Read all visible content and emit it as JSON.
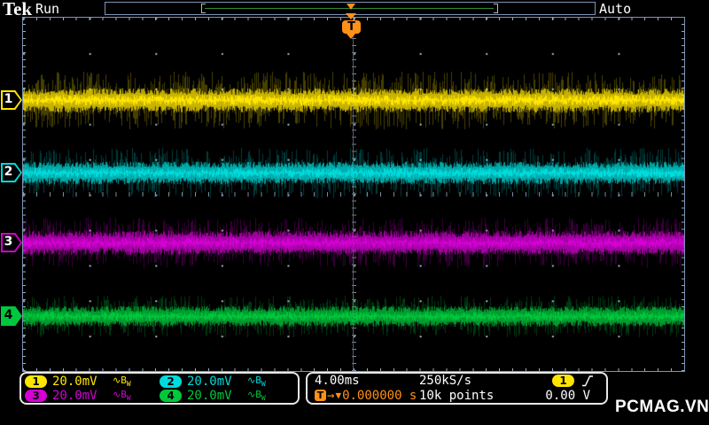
{
  "header": {
    "logo": "Tek",
    "acq_state": "Run",
    "trigger_mode": "Auto"
  },
  "channels": [
    {
      "label": "1",
      "scale": "20.0mV",
      "color": "#ffe600",
      "marker_filled": false,
      "trace": {
        "center": 94,
        "core": 14,
        "spike": 26
      }
    },
    {
      "label": "2",
      "scale": "20.0mV",
      "color": "#00dbdb",
      "marker_filled": false,
      "trace": {
        "center": 176,
        "core": 13,
        "spike": 22
      }
    },
    {
      "label": "3",
      "scale": "20.0mV",
      "color": "#d400d4",
      "marker_filled": false,
      "trace": {
        "center": 255,
        "core": 14,
        "spike": 22
      }
    },
    {
      "label": "4",
      "scale": "20.0mV",
      "color": "#00c83c",
      "marker_filled": true,
      "trace": {
        "center": 338,
        "core": 12,
        "spike": 18
      }
    }
  ],
  "icons": {
    "coupling_glyph": "∿",
    "bw_main": "B",
    "bw_sub": "W",
    "delay_t": "T",
    "delay_arrow": "→",
    "delay_marker": "▼"
  },
  "horizontal": {
    "scale": "4.00ms",
    "sample_rate": "250kS/s",
    "record_length": "10k points",
    "delay": "0.000000 s"
  },
  "trigger": {
    "source": "1",
    "source_color": "#ffe600",
    "level": "0.00 V",
    "slope": "rising"
  },
  "watermark": "PCMAG.VN",
  "colors": {
    "frame": "#7e95b5",
    "orange": "#ff9118",
    "record_line": "#2f8b2f"
  }
}
